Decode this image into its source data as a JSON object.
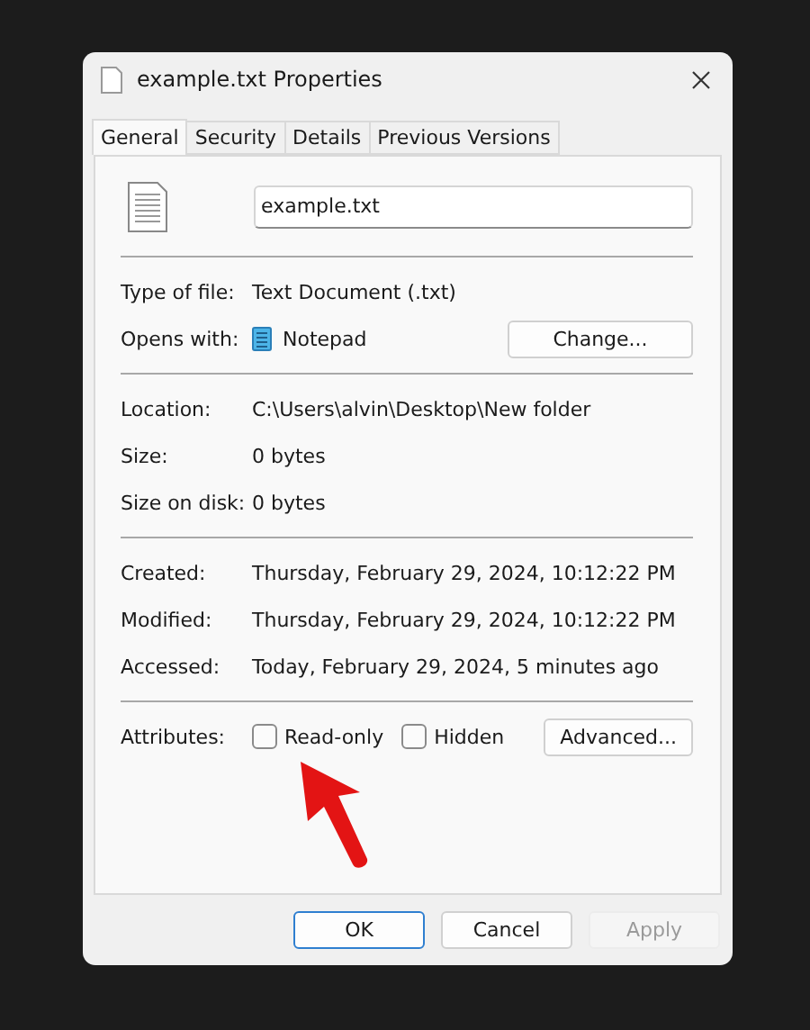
{
  "window": {
    "title": "example.txt Properties"
  },
  "tabs": [
    {
      "label": "General",
      "selected": true
    },
    {
      "label": "Security",
      "selected": false
    },
    {
      "label": "Details",
      "selected": false
    },
    {
      "label": "Previous Versions",
      "selected": false
    }
  ],
  "file_name": "example.txt",
  "sections": [
    [
      {
        "kind": "text",
        "label": "Type of file:",
        "value": "Text Document (.txt)"
      },
      {
        "kind": "app",
        "label": "Opens with:",
        "value": "Notepad",
        "button": "Change..."
      }
    ],
    [
      {
        "kind": "text",
        "label": "Location:",
        "value": "C:\\Users\\alvin\\Desktop\\New folder"
      },
      {
        "kind": "text",
        "label": "Size:",
        "value": "0 bytes"
      },
      {
        "kind": "text",
        "label": "Size on disk:",
        "value": "0 bytes"
      }
    ],
    [
      {
        "kind": "text",
        "label": "Created:",
        "value": "Thursday, February 29, 2024, 10:12:22 PM"
      },
      {
        "kind": "text",
        "label": "Modified:",
        "value": "Thursday, February 29, 2024, 10:12:22 PM"
      },
      {
        "kind": "text",
        "label": "Accessed:",
        "value": "Today, February 29, 2024, 5 minutes ago"
      }
    ]
  ],
  "attributes": {
    "label": "Attributes:",
    "checkboxes": [
      {
        "label": "Read-only",
        "checked": false
      },
      {
        "label": "Hidden",
        "checked": false
      }
    ],
    "button": "Advanced..."
  },
  "buttons": [
    {
      "label": "OK",
      "default": true,
      "disabled": false
    },
    {
      "label": "Cancel",
      "default": false,
      "disabled": false
    },
    {
      "label": "Apply",
      "default": false,
      "disabled": true
    }
  ]
}
